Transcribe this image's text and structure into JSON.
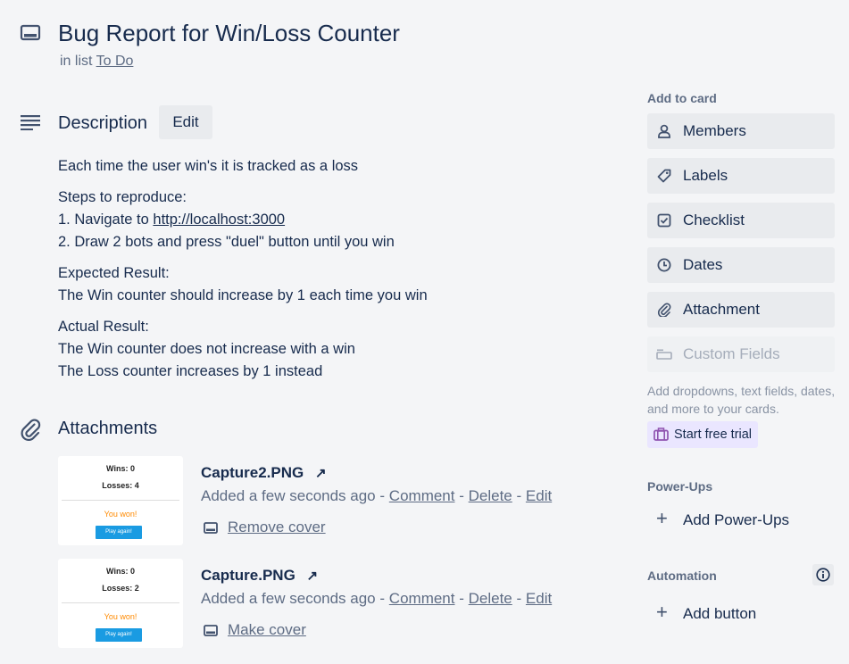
{
  "header": {
    "title": "Bug Report for Win/Loss Counter",
    "in_list_prefix": "in list",
    "list_name": "To Do"
  },
  "description": {
    "title": "Description",
    "edit_label": "Edit",
    "line1": "Each time the user win's it is tracked as a loss",
    "steps_heading": "Steps to reproduce:",
    "step1_prefix": "1. Navigate to ",
    "step1_link": "http://localhost:3000",
    "step2": "2. Draw 2 bots and press \"duel\" button until you win",
    "expected_heading": "Expected Result:",
    "expected_text": "The Win counter should increase by 1 each time you win",
    "actual_heading": "Actual Result:",
    "actual_line1": "The Win counter does not increase with a win",
    "actual_line2": "The Loss counter increases by 1 instead"
  },
  "attachments": {
    "title": "Attachments",
    "items": [
      {
        "name": "Capture2.PNG",
        "added": "Added a few seconds ago",
        "sep": "-",
        "comment": "Comment",
        "delete": "Delete",
        "edit": "Edit",
        "cover_action": "Remove cover",
        "thumb": {
          "wins": "Wins: 0",
          "losses": "Losses: 4",
          "won": "You won!",
          "play": "Play again!"
        }
      },
      {
        "name": "Capture.PNG",
        "added": "Added a few seconds ago",
        "sep": "-",
        "comment": "Comment",
        "delete": "Delete",
        "edit": "Edit",
        "cover_action": "Make cover",
        "thumb": {
          "wins": "Wins: 0",
          "losses": "Losses: 2",
          "won": "You won!",
          "play": "Play again!"
        }
      }
    ]
  },
  "sidebar": {
    "add_to_card_label": "Add to card",
    "buttons": [
      {
        "label": "Members",
        "icon": "person-icon"
      },
      {
        "label": "Labels",
        "icon": "tag-icon"
      },
      {
        "label": "Checklist",
        "icon": "checkbox-icon"
      },
      {
        "label": "Dates",
        "icon": "clock-icon"
      },
      {
        "label": "Attachment",
        "icon": "paperclip-icon"
      },
      {
        "label": "Custom Fields",
        "icon": "fields-icon"
      }
    ],
    "custom_fields_help": "Add dropdowns, text fields, dates, and more to your cards.",
    "trial_label": "Start free trial",
    "powerups_label": "Power-Ups",
    "add_powerups": "Add Power-Ups",
    "automation_label": "Automation",
    "add_button": "Add button"
  },
  "colors": {
    "background": "#f4f5f7",
    "text": "#172b4d",
    "subtle_text": "#5e6c84",
    "button_bg": "#e9ebee",
    "trial_bg": "#eae6ff",
    "accent_orange": "#ff8a00",
    "accent_blue": "#1a9be2"
  }
}
